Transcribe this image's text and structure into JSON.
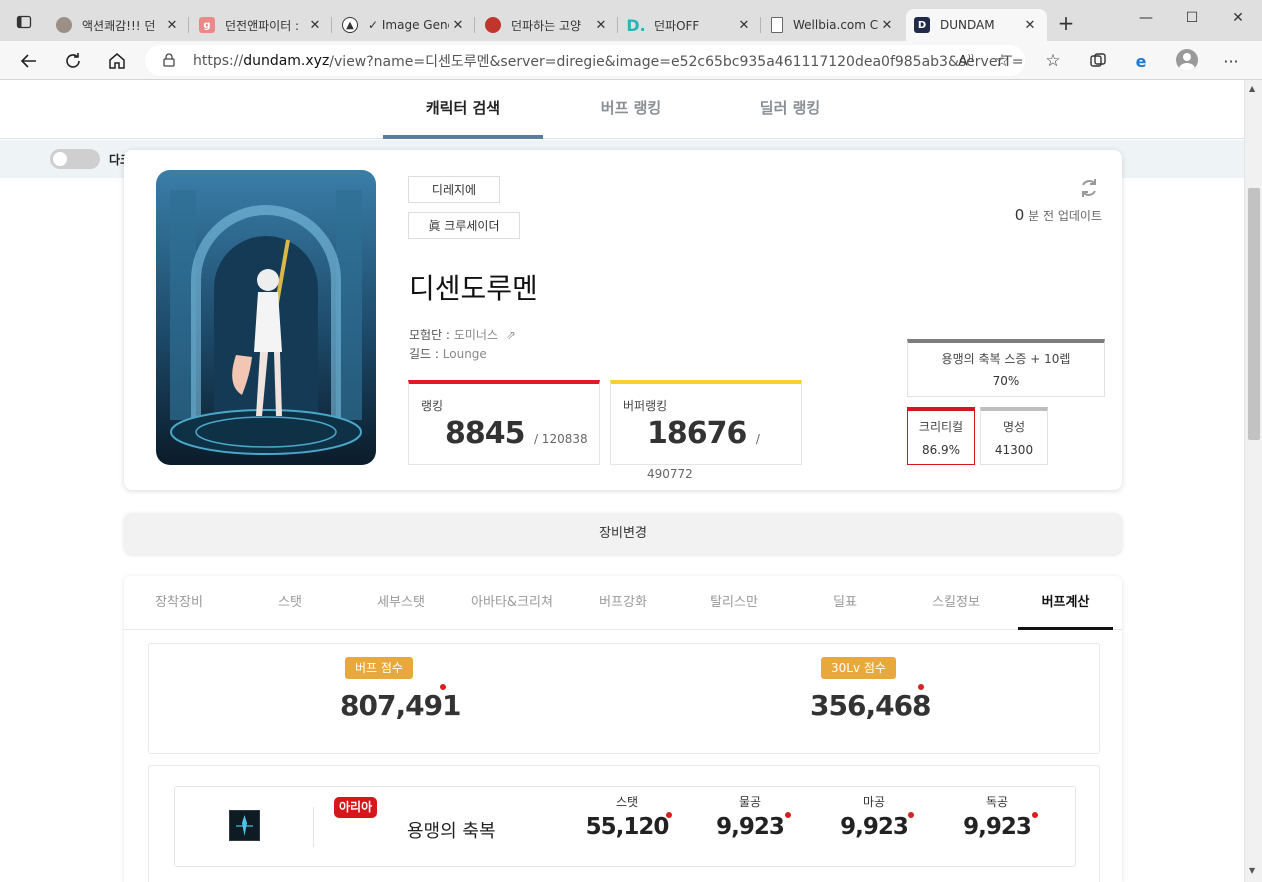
{
  "browser": {
    "tabs": [
      {
        "title": "액션쾌감!!! 던",
        "favicon_color": "#9b8f86"
      },
      {
        "title": "던전앤파이터 :",
        "favicon_color": "#e88a8a"
      },
      {
        "title": "✓ Image Gene",
        "favicon_color": "#ffffff"
      },
      {
        "title": "던파하는 고양",
        "favicon_color": "#c0362c"
      },
      {
        "title": "던파OFF",
        "favicon_color": "#27b6b6"
      },
      {
        "title": "Wellbia.com C",
        "favicon_color": "#ffffff"
      },
      {
        "title": "DUNDAM",
        "favicon_color": "#1f2b48"
      }
    ],
    "active_tab": 6,
    "url_prefix": "https://",
    "url_host": "dundam.xyz",
    "url_rest": "/view?name=디센도루멘&server=diregie&image=e52c65bc935a461117120dea0f985ab3&serverT="
  },
  "site": {
    "nav": [
      "캐릭터 검색",
      "버프 랭킹",
      "딜러 랭킹"
    ],
    "dark_mode_label": "다크모드로 보기"
  },
  "character": {
    "server": "디레지에",
    "job": "眞 크루세이더",
    "name": "디센도루멘",
    "adventure_label": "모험단 :",
    "adventure": "도미너스",
    "guild_label": "길드 :",
    "guild": "Lounge",
    "updated_num": "0",
    "updated_text": "분 전 업데이트",
    "ranking": {
      "label": "랭킹",
      "value": "8845",
      "total": "/ 120838",
      "color": "#e01b22"
    },
    "buffer_ranking": {
      "label": "버퍼랭킹",
      "value": "18676",
      "total": "/ 490772",
      "color": "#f5d32a"
    },
    "buff_level": {
      "label": "용맹의 축복 스증 + 10렙",
      "value": "70%"
    },
    "critical": {
      "label": "크리티컬",
      "value": "86.9%"
    },
    "fame": {
      "label": "명성",
      "value": "41300"
    }
  },
  "equip_change": "장비변경",
  "detail_tabs": [
    "장착장비",
    "스탯",
    "세부스탯",
    "아바타&크리쳐",
    "버프강화",
    "탈리스만",
    "딜표",
    "스킬정보",
    "버프계산"
  ],
  "active_detail_tab": 8,
  "scores": {
    "buff": {
      "label": "버프 점수",
      "value": "807,491"
    },
    "lv30": {
      "label": "30Lv 점수",
      "value": "356,468"
    }
  },
  "skill": {
    "badge": "아리아",
    "name": "용맹의 축복",
    "stats": [
      {
        "label": "스탯",
        "value": "55,120"
      },
      {
        "label": "물공",
        "value": "9,923"
      },
      {
        "label": "마공",
        "value": "9,923"
      },
      {
        "label": "독공",
        "value": "9,923"
      }
    ]
  }
}
